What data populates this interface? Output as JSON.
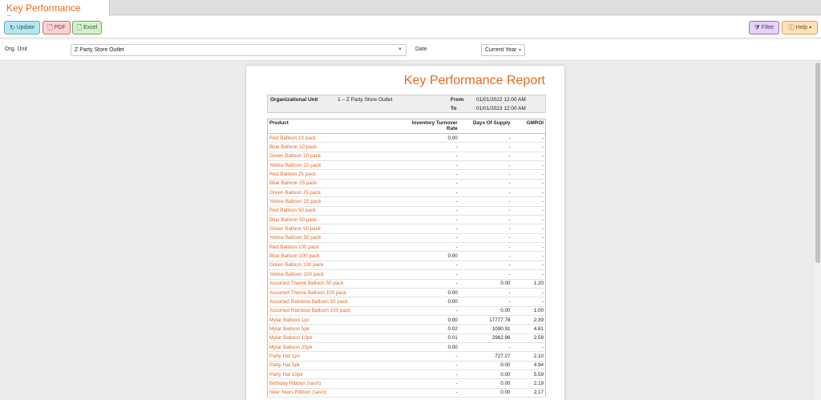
{
  "tab": {
    "title": "Key Performance Report"
  },
  "toolbar": {
    "update_label": "Update",
    "pdf_label": "PDF",
    "excel_label": "Excel",
    "filter_label": "Filter",
    "help_label": "Help"
  },
  "params": {
    "org_unit_label": "Org. Unit",
    "org_unit_value": "Z Party Store Outlet",
    "date_label": "Date",
    "date_value": "Current Year"
  },
  "report": {
    "title": "Key Performance Report",
    "org_label": "Organizational Unit",
    "org_value": "1 – Z Party Store Outlet",
    "from_label": "From",
    "from_value": "01/01/2022 12:00 AM",
    "to_label": "To",
    "to_value": "01/01/2023 12:00 AM",
    "columns": [
      "Product",
      "Inventory Turnover Rate",
      "Days Of Supply",
      "GMROI"
    ],
    "rows": [
      [
        "Red Balloon 10 pack",
        "0.00",
        "-",
        "-"
      ],
      [
        "Blue Balloon 10 pack",
        "-",
        "-",
        "-"
      ],
      [
        "Green Balloon 10 pack",
        "-",
        "-",
        "-"
      ],
      [
        "Yellow Balloon 10 pack",
        "-",
        "-",
        "-"
      ],
      [
        "Red Balloon 25 pack",
        "-",
        "-",
        "-"
      ],
      [
        "Blue Balloon 25 pack",
        "-",
        "-",
        "-"
      ],
      [
        "Green Balloon 25 pack",
        "-",
        "-",
        "-"
      ],
      [
        "Yellow Balloon 25 pack",
        "-",
        "-",
        "-"
      ],
      [
        "Red Balloon 50 pack",
        "-",
        "-",
        "-"
      ],
      [
        "Blue Balloon 50 pack",
        "-",
        "-",
        "-"
      ],
      [
        "Green Balloon 50 pack",
        "-",
        "-",
        "-"
      ],
      [
        "Yellow Balloon 50 pack",
        "-",
        "-",
        "-"
      ],
      [
        "Red Balloon 100 pack",
        "-",
        "-",
        "-"
      ],
      [
        "Blue Balloon 100 pack",
        "0.00",
        "-",
        "-"
      ],
      [
        "Green Balloon 100 pack",
        "-",
        "-",
        "-"
      ],
      [
        "Yellow Balloon 100 pack",
        "-",
        "-",
        "-"
      ],
      [
        "Assorted Theme Balloon 50 pack",
        "-",
        "0.00",
        "1.20"
      ],
      [
        "Assorted Theme Balloon 100 pack",
        "0.00",
        "-",
        "-"
      ],
      [
        "Assorted Rainbow Balloon 50 pack",
        "0.00",
        "-",
        "-"
      ],
      [
        "Assorted Rainbow Balloon 100 pack",
        "-",
        "0.00",
        "1.00"
      ],
      [
        "Mylar Balloon 1pc",
        "0.00",
        "17777.78",
        "2.39"
      ],
      [
        "Mylar Balloon 5pk",
        "0.02",
        "1090.91",
        "4.81"
      ],
      [
        "Mylar Balloon 10pk",
        "0.01",
        "2962.96",
        "2.59"
      ],
      [
        "Mylar Balloon 25pk",
        "0.00",
        "-",
        "-"
      ],
      [
        "Party Hat 1pc",
        "-",
        "727.27",
        "2.10"
      ],
      [
        "Party Hat 5pk",
        "-",
        "0.00",
        "4.94"
      ],
      [
        "Party Hat 10pk",
        "-",
        "0.00",
        "5.59"
      ],
      [
        "Birthday Ribbon (sash)",
        "-",
        "0.00",
        "2.19"
      ],
      [
        "New Years Ribbon (sash)",
        "-",
        "0.00",
        "2.17"
      ]
    ]
  },
  "colors": {
    "accent": "#e8681d"
  }
}
